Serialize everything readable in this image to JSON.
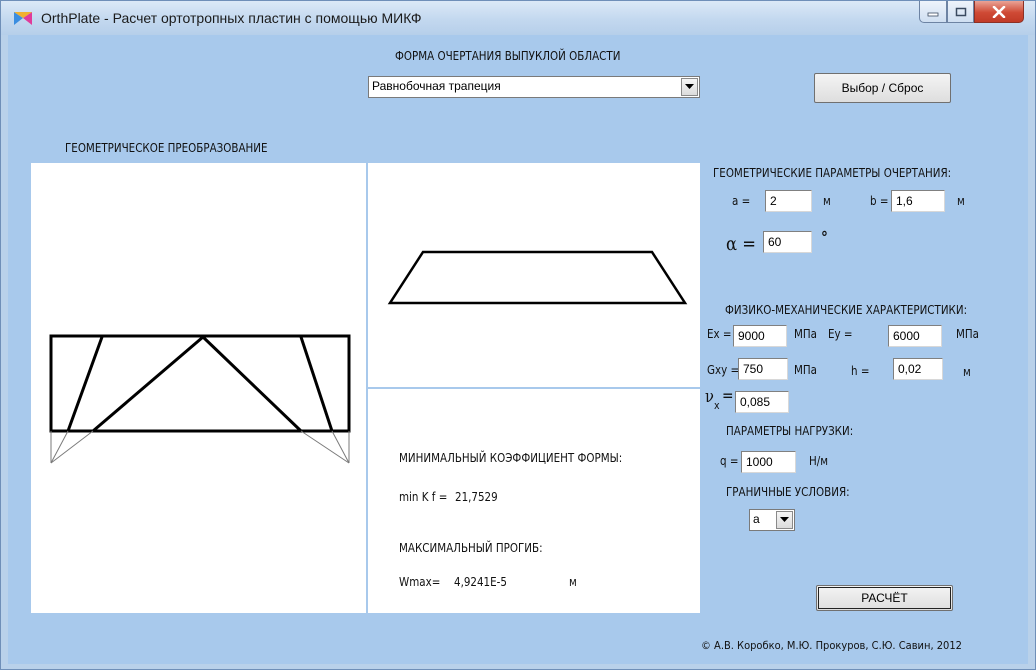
{
  "window": {
    "title": "OrthPlate - Расчет ортотропных пластин с помощью МИКФ"
  },
  "shape": {
    "heading": "ФОРМА ОЧЕРТАНИЯ ВЫПУКЛОЙ ОБЛАСТИ",
    "selected": "Равнобочная трапеция",
    "select_reset_label": "Выбор / Сброс"
  },
  "transform": {
    "heading": "ГЕОМЕТРИЧЕСКОЕ ПРЕОБРАЗОВАНИЕ"
  },
  "geometry": {
    "heading": "ГЕОМЕТРИЧЕСКИЕ ПАРАМЕТРЫ ОЧЕРТАНИЯ:",
    "a_label": "а =",
    "a_value": "2",
    "a_unit": "м",
    "b_label": "b =",
    "b_value": "1,6",
    "b_unit": "м",
    "alpha_label": "α =",
    "alpha_value": "60",
    "alpha_unit": "°"
  },
  "physics": {
    "heading": "ФИЗИКО-МЕХАНИЧЕСКИЕ ХАРАКТЕРИСТИКИ:",
    "ex_label": "Ex =",
    "ex_value": "9000",
    "ex_unit": "МПа",
    "ey_label": "Ey =",
    "ey_value": "6000",
    "ey_unit": "МПа",
    "gxy_label": "Gxy =",
    "gxy_value": "750",
    "gxy_unit": "МПа",
    "h_label": "h =",
    "h_value": "0,02",
    "h_unit": "м",
    "nu_label": "ν",
    "nu_sub": "x",
    "nu_eq": "=",
    "nu_value": "0,085"
  },
  "load": {
    "heading": "ПАРАМЕТРЫ НАГРУЗКИ:",
    "q_label": "q =",
    "q_value": "1000",
    "q_unit": "Н/м"
  },
  "boundary": {
    "heading": "ГРАНИЧНЫЕ УСЛОВИЯ:",
    "selected": "a"
  },
  "results": {
    "kf_heading": "МИНИМАЛЬНЫЙ КОЭФФИЦИЕНТ ФОРМЫ:",
    "kf_label": "min K f =",
    "kf_value": "21,7529",
    "w_heading": "МАКСИМАЛЬНЫЙ ПРОГИБ:",
    "w_label": "Wmax=",
    "w_value": "4,9241E-5",
    "w_unit": "м"
  },
  "calc_button_label": "РАСЧЁТ",
  "copyright": "© А.В. Коробко, М.Ю. Прокуров, С.Ю. Савин, 2012",
  "icons": {
    "app": "app-icon",
    "minimize": "minimize-icon",
    "maximize": "maximize-icon",
    "close": "close-icon",
    "dropdown": "chevron-down-icon"
  }
}
